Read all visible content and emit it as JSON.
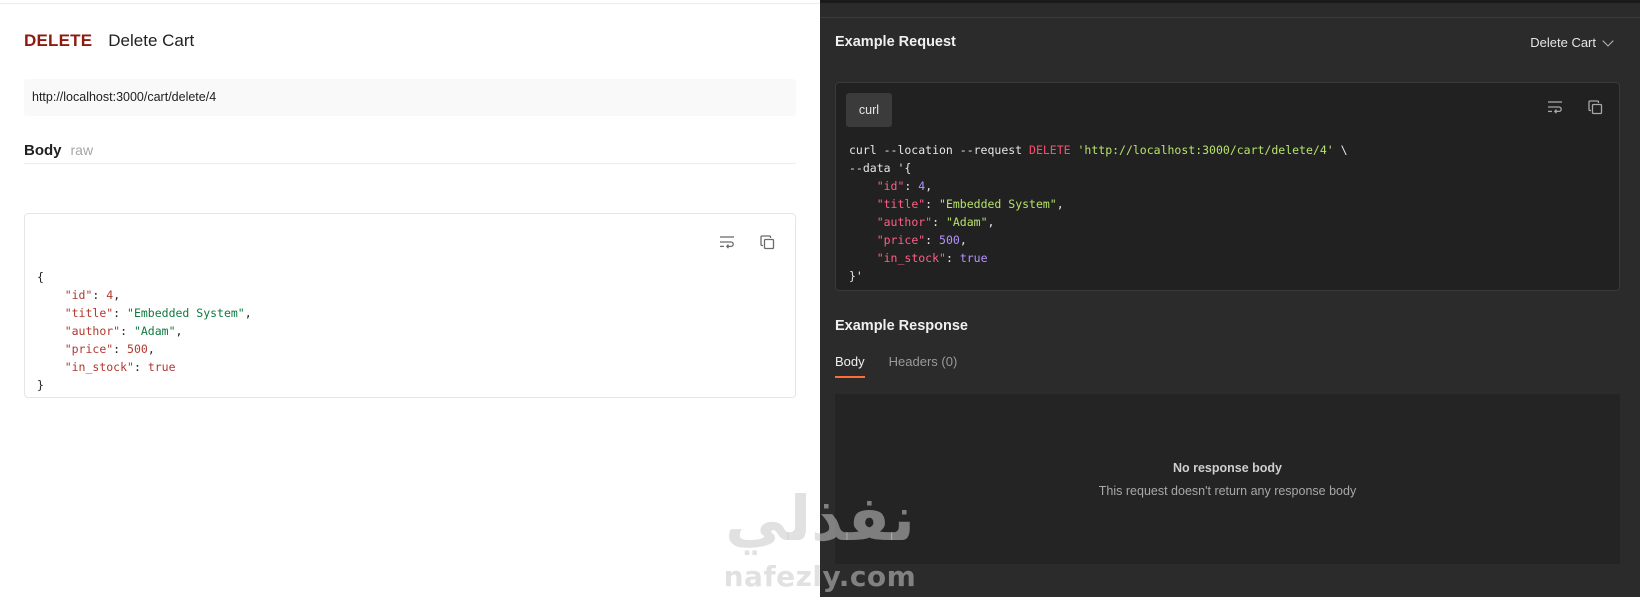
{
  "request": {
    "method": "DELETE",
    "name": "Delete Cart",
    "url": "http://localhost:3000/cart/delete/4",
    "body_label": "Body",
    "body_mode": "raw",
    "body_json": {
      "open": "{",
      "close": "}",
      "fields": [
        {
          "key": "\"id\"",
          "value": "4",
          "type": "number",
          "comma": ","
        },
        {
          "key": "\"title\"",
          "value": "\"Embedded System\"",
          "type": "string",
          "comma": ","
        },
        {
          "key": "\"author\"",
          "value": "\"Adam\"",
          "type": "string",
          "comma": ","
        },
        {
          "key": "\"price\"",
          "value": "500",
          "type": "number",
          "comma": ","
        },
        {
          "key": "\"in_stock\"",
          "value": "true",
          "type": "bool",
          "comma": ""
        }
      ]
    }
  },
  "example_request": {
    "title": "Example Request",
    "selected_example": "Delete Cart",
    "language_tab": "curl",
    "curl": {
      "cmd": "curl --location --request ",
      "method": "DELETE",
      "url": "'http://localhost:3000/cart/delete/4'",
      "cont": " \\",
      "data_flag": "--data '{",
      "end": "}'"
    }
  },
  "example_response": {
    "title": "Example Response",
    "tabs": [
      {
        "label": "Body",
        "active": true
      },
      {
        "label": "Headers (0)",
        "active": false
      }
    ],
    "empty_title": "No response body",
    "empty_subtitle": "This request doesn't return any response body"
  },
  "watermark": {
    "arabic": "نفذلي",
    "latin": "nafezly.com"
  },
  "colors": {
    "method_delete": "#8e1a10",
    "active_tab_underline": "#ff6c37",
    "dark_bg": "#2b2b2b"
  },
  "icons": [
    "wrap-text-icon",
    "copy-icon",
    "chevron-down-icon"
  ]
}
